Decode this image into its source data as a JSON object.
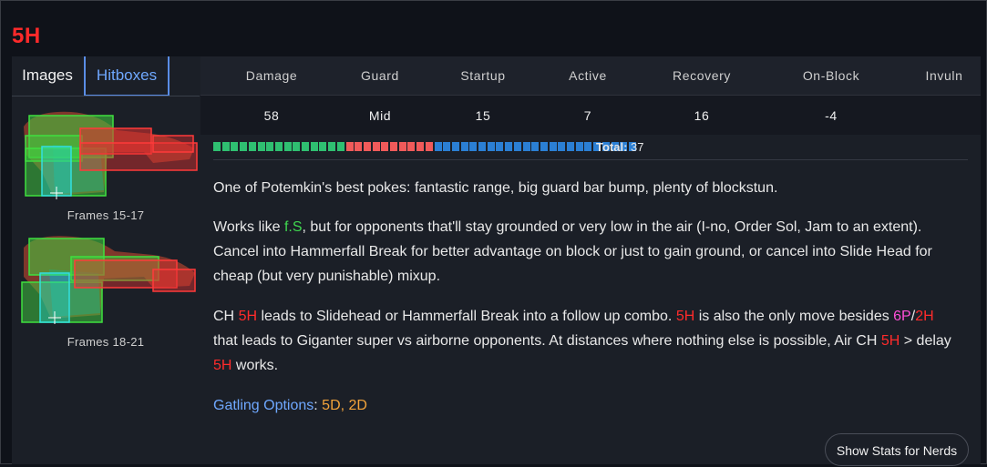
{
  "move": {
    "name": "5H"
  },
  "tabs": [
    {
      "label": "Images",
      "active": false
    },
    {
      "label": "Hitboxes",
      "active": true
    }
  ],
  "figures": [
    {
      "caption": "Frames 15-17"
    },
    {
      "caption": "Frames 18-21"
    }
  ],
  "stats": {
    "headers": [
      "Damage",
      "Guard",
      "Startup",
      "Active",
      "Recovery",
      "On-Block",
      "Invuln"
    ],
    "values": [
      "58",
      "Mid",
      "15",
      "7",
      "16",
      "-4",
      ""
    ]
  },
  "framebar": {
    "startup_frames": 15,
    "active_frames": 10,
    "recovery_frames": 23,
    "colors": {
      "startup": "#2fbf71",
      "active": "#f05a5a",
      "recovery": "#2b7fd4"
    },
    "total_label": "Total:",
    "total_value": "37"
  },
  "description": {
    "p1": "One of Potemkin's best pokes: fantastic range, big guard bar bump, plenty of blockstun.",
    "p2": {
      "a": "Works like ",
      "link1": "f.S",
      "b": ", but for opponents that'll stay grounded or very low in the air (I-no, Order Sol, Jam to an extent). Cancel into Hammerfall Break for better advantage on block or just to gain ground, or cancel into Slide Head for cheap (but very punishable) mixup."
    },
    "p3": {
      "a": "CH ",
      "m1": "5H",
      "b": " leads to Slidehead or Hammerfall Break into a follow up combo. ",
      "m2": "5H",
      "c": " is also the only move besides ",
      "m3": "6P",
      "slash": "/",
      "m4": "2H",
      "d": " that leads to Giganter super vs airborne opponents. At distances where nothing else is possible, Air CH ",
      "m5": "5H",
      "e": " > delay ",
      "m6": "5H",
      "f": " works."
    },
    "gatling": {
      "label": "Gatling Options",
      "colon": ": ",
      "opt1": "5D",
      "sep": ", ",
      "opt2": "2D"
    }
  },
  "buttons": {
    "nerds": "Show Stats for Nerds"
  },
  "colors": {
    "title_red": "#ff2a2a",
    "link_blue": "#6fa8ff",
    "gatling_orange": "#f2a33a",
    "move_green": "#3fd74f",
    "move_pink": "#ff4fd8"
  }
}
